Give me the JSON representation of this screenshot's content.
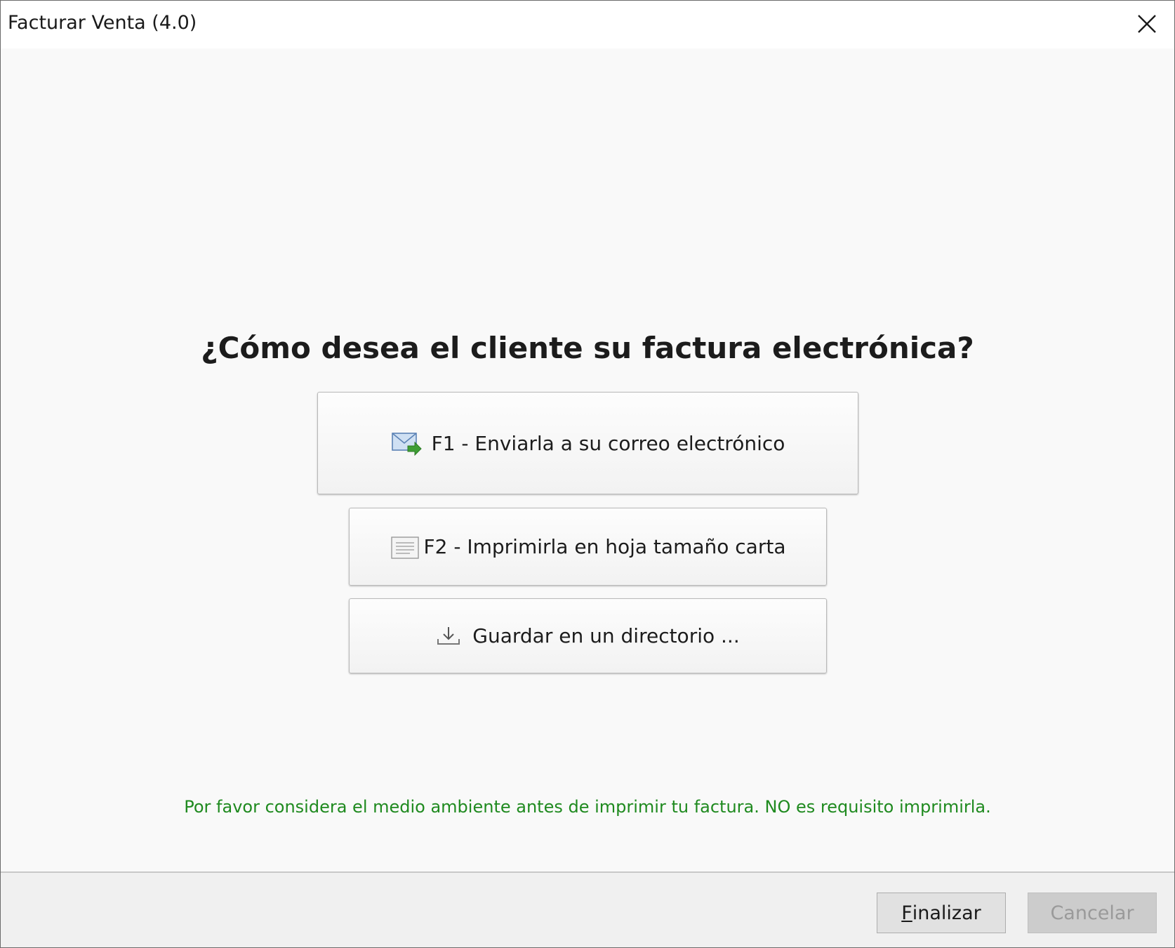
{
  "window": {
    "title": "Facturar Venta (4.0)"
  },
  "main": {
    "question": "¿Cómo desea el cliente su factura electrónica?",
    "options": [
      {
        "label": "F1 - Enviarla a su correo electrónico",
        "icon": "email-send-icon"
      },
      {
        "label": "F2 - Imprimirla en hoja tamaño carta",
        "icon": "document-icon"
      },
      {
        "label": "Guardar en un directorio ...",
        "icon": "download-icon"
      }
    ],
    "eco_note": "Por favor considera el medio ambiente antes de imprimir tu factura. NO es requisito imprimirla."
  },
  "footer": {
    "finalizar_mnemonic": "F",
    "finalizar_rest": "inalizar",
    "cancelar_label": "Cancelar"
  },
  "colors": {
    "eco_note": "#1f8a1f",
    "disabled_text": "#9a9a9a"
  }
}
